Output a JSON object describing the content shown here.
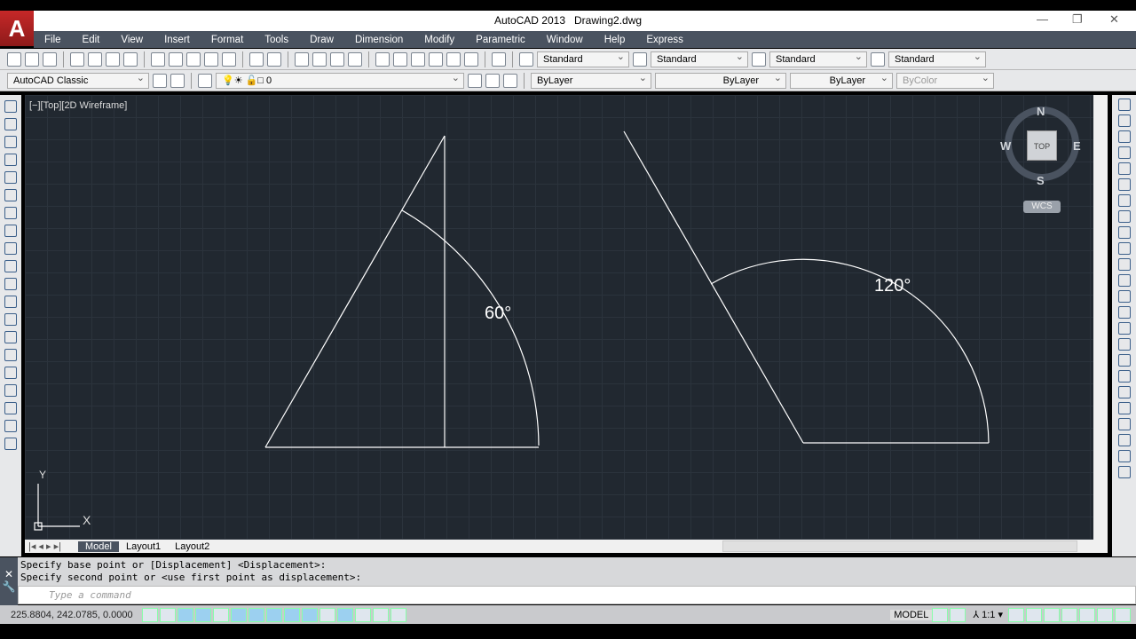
{
  "app": {
    "title": "AutoCAD 2013",
    "document": "Drawing2.dwg"
  },
  "menu": [
    "File",
    "Edit",
    "View",
    "Insert",
    "Format",
    "Tools",
    "Draw",
    "Dimension",
    "Modify",
    "Parametric",
    "Window",
    "Help",
    "Express"
  ],
  "styles": {
    "text_style": "Standard",
    "dim_style": "Standard",
    "table_style": "Standard",
    "mleader_style": "Standard"
  },
  "workspace": "AutoCAD Classic",
  "layer": "0",
  "properties": {
    "color": "ByLayer",
    "linetype": "ByLayer",
    "lineweight": "ByLayer",
    "plotstyle": "ByColor"
  },
  "viewport_label": "[−][Top][2D Wireframe]",
  "viewcube": {
    "n": "N",
    "s": "S",
    "e": "E",
    "w": "W",
    "face": "TOP",
    "ucs": "WCS"
  },
  "ucs_icon": {
    "x": "X",
    "y": "Y"
  },
  "dimensions": [
    "60°",
    "120°"
  ],
  "tabs": [
    "Model",
    "Layout1",
    "Layout2"
  ],
  "command": {
    "history": [
      "Specify base point or [Displacement] <Displacement>:",
      "Specify second point or <use first point as displacement>:"
    ],
    "placeholder": "Type a command"
  },
  "status": {
    "coords": "225.8804, 242.0785, 0.0000",
    "space": "MODEL",
    "scale": "1:1"
  },
  "colors": {
    "canvas": "#212830",
    "menubar": "#4a5360",
    "linework": "#ffffff"
  }
}
